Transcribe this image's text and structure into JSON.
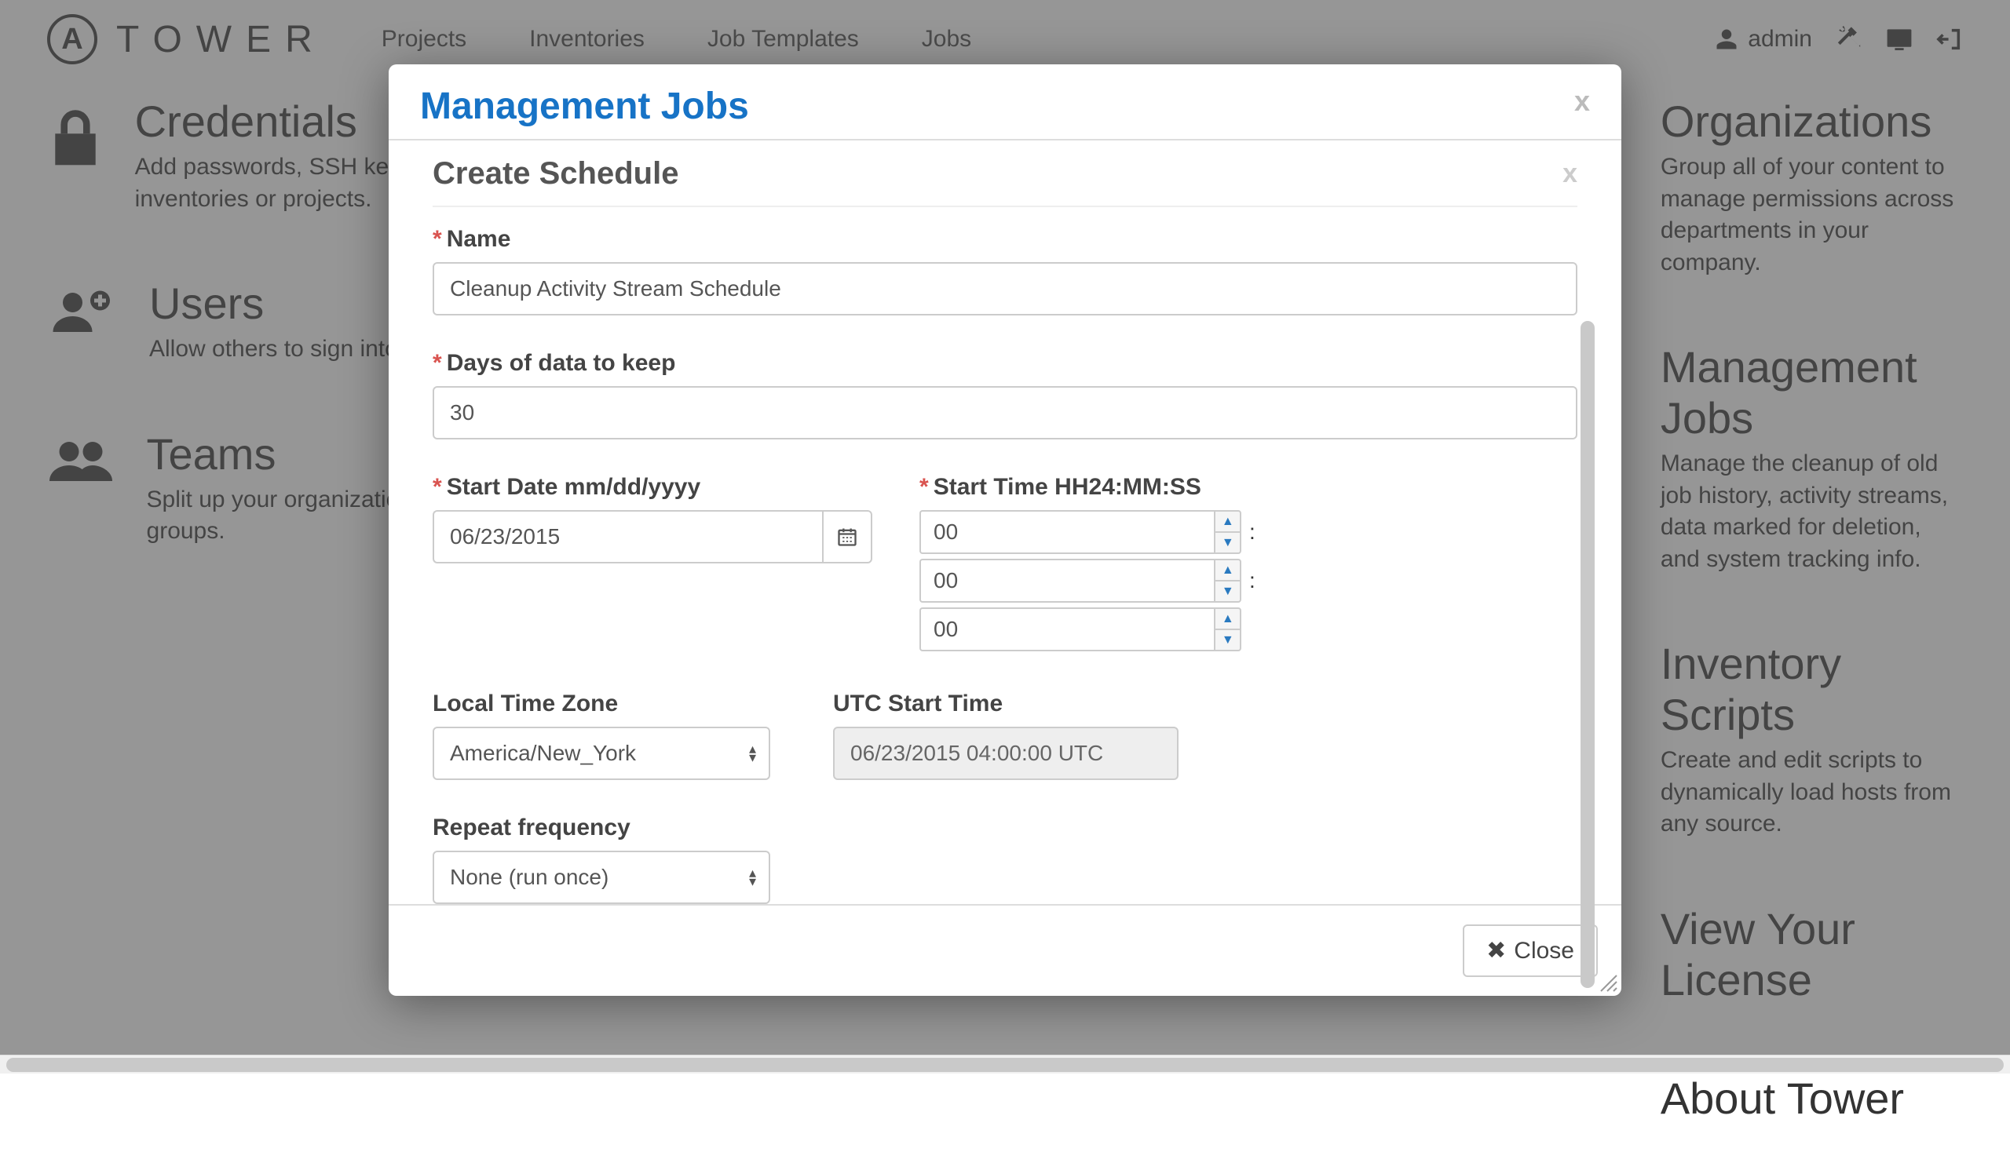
{
  "brand": {
    "logo_letter": "A",
    "text": "TOWER"
  },
  "nav": {
    "links": [
      "Projects",
      "Inventories",
      "Job Templates",
      "Jobs"
    ],
    "username": "admin"
  },
  "tiles": {
    "left": [
      {
        "title": "Credentials",
        "desc": "Add passwords, SSH keys, etc. for Tower to use when launching jobs against inventories or projects."
      },
      {
        "title": "Users",
        "desc": "Allow others to sign into Tower and own content they create."
      },
      {
        "title": "Teams",
        "desc": "Split up your organization to associate content and control permissions for groups."
      }
    ],
    "right": [
      {
        "title": "Organizations",
        "desc": "Group all of your content to manage permissions across departments in your company."
      },
      {
        "title": "Management Jobs",
        "desc": "Manage the cleanup of old job history, activity streams, data marked for deletion, and system tracking info."
      },
      {
        "title": "Inventory Scripts",
        "desc": "Create and edit scripts to dynamically load hosts from any source."
      },
      {
        "title": "View Your License",
        "desc": ""
      },
      {
        "title": "About Tower",
        "desc": ""
      }
    ]
  },
  "modal": {
    "title": "Management Jobs",
    "inner_title": "Create Schedule",
    "close_label": "Close",
    "fields": {
      "name_label": "Name",
      "name_value": "Cleanup Activity Stream Schedule",
      "days_label": "Days of data to keep",
      "days_value": "30",
      "start_date_label": "Start Date mm/dd/yyyy",
      "start_date_value": "06/23/2015",
      "start_time_label": "Start Time HH24:MM:SS",
      "hh": "00",
      "mm": "00",
      "ss": "00",
      "tz_label": "Local Time Zone",
      "tz_value": "America/New_York",
      "utc_label": "UTC Start Time",
      "utc_value": "06/23/2015 04:00:00 UTC",
      "repeat_label": "Repeat frequency",
      "repeat_value": "None (run once)"
    }
  }
}
